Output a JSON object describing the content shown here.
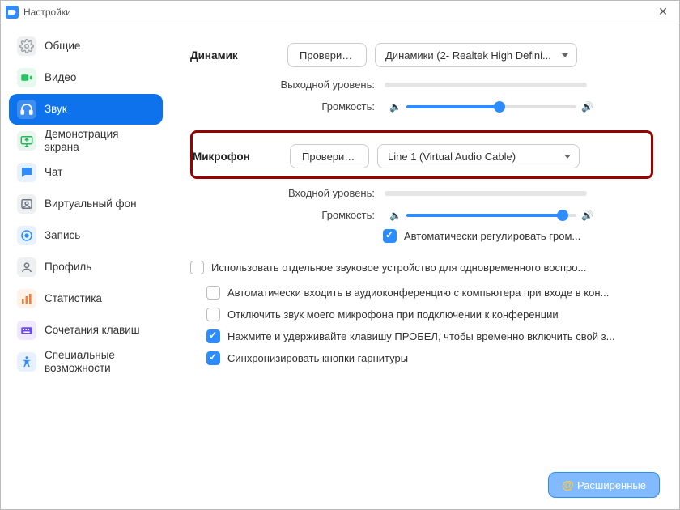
{
  "title": "Настройки",
  "sidebar": {
    "items": [
      {
        "label": "Общие"
      },
      {
        "label": "Видео"
      },
      {
        "label": "Звук"
      },
      {
        "label": "Демонстрация экрана"
      },
      {
        "label": "Чат"
      },
      {
        "label": "Виртуальный фон"
      },
      {
        "label": "Запись"
      },
      {
        "label": "Профиль"
      },
      {
        "label": "Статистика"
      },
      {
        "label": "Сочетания клавиш"
      },
      {
        "label": "Специальные возможности"
      }
    ]
  },
  "speaker": {
    "label": "Динамик",
    "test": "Проверить ...",
    "device": "Динамики (2- Realtek High Defini...",
    "output_level": "Выходной уровень:",
    "volume_label": "Громкость:",
    "volume_pct": 55
  },
  "mic": {
    "label": "Микрофон",
    "test": "Проверить ...",
    "device": "Line 1 (Virtual Audio Cable)",
    "input_level": "Входной уровень:",
    "volume_label": "Громкость:",
    "volume_pct": 92,
    "auto_adjust": "Автоматически регулировать гром..."
  },
  "options": {
    "separate_audio": "Использовать отдельное звуковое устройство для одновременного воспро...",
    "auto_join": "Автоматически входить в аудиоконференцию с компьютера при входе в кон...",
    "mute_mic": "Отключить звук моего микрофона при подключении к конференции",
    "space_unmute": "Нажмите и удерживайте клавишу ПРОБЕЛ, чтобы временно включить свой з...",
    "sync_headset": "Синхронизировать кнопки гарнитуры"
  },
  "advanced_btn": "Расширенные"
}
